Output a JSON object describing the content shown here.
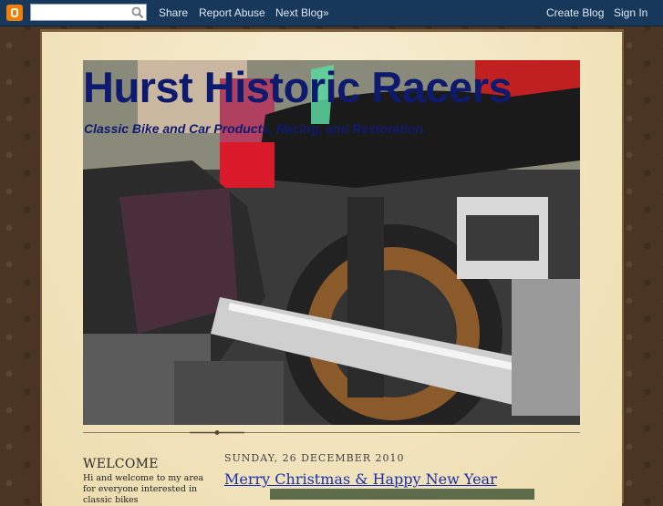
{
  "navbar": {
    "search_placeholder": "",
    "share": "Share",
    "report_abuse": "Report Abuse",
    "next_blog": "Next Blog»",
    "create_blog": "Create Blog",
    "sign_in": "Sign In"
  },
  "header": {
    "title": "Hurst Historic Racers",
    "description": "Classic Bike and Car Products, Racing, and Restoration."
  },
  "sidebar": {
    "title": "WELCOME",
    "text": "Hi and welcome to my area for everyone interested in classic bikes"
  },
  "post": {
    "date": "SUNDAY, 26 DECEMBER 2010",
    "title": "Merry Christmas & Happy New Year"
  },
  "colors": {
    "navbar": "#17385a",
    "title": "#0d1a6e",
    "link": "#1a2fb0",
    "panel": "#f2e6c2"
  }
}
